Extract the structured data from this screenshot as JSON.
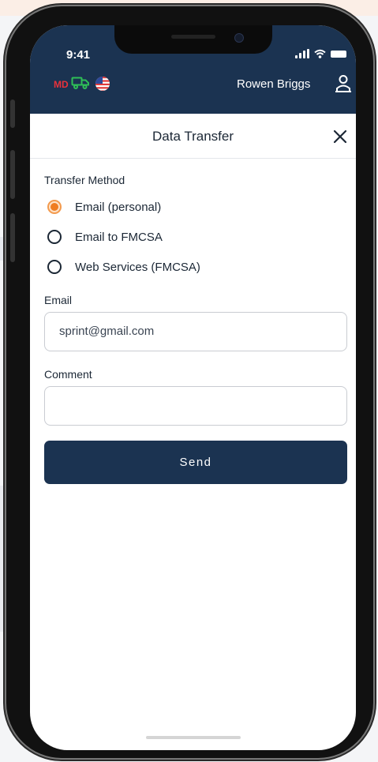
{
  "status_bar": {
    "time": "9:41"
  },
  "app_header": {
    "md_badge": "MD",
    "user_name": "Rowen Briggs"
  },
  "dialog": {
    "title": "Data Transfer",
    "transfer_method_label": "Transfer Method",
    "options": [
      {
        "label": "Email (personal)",
        "selected": true
      },
      {
        "label": "Email to FMCSA",
        "selected": false
      },
      {
        "label": "Web Services (FMCSA)",
        "selected": false
      }
    ],
    "email_label": "Email",
    "email_value": "sprint@gmail.com",
    "comment_label": "Comment",
    "comment_value": "",
    "send_label": "Send"
  },
  "colors": {
    "header_bg": "#1b3351",
    "accent_orange": "#ef7d22",
    "md_red": "#e9323b",
    "truck_green": "#2fbf57"
  },
  "icons": [
    "truck-icon",
    "us-flag-icon",
    "user-icon",
    "close-icon",
    "signal-icon",
    "wifi-icon",
    "battery-icon"
  ]
}
